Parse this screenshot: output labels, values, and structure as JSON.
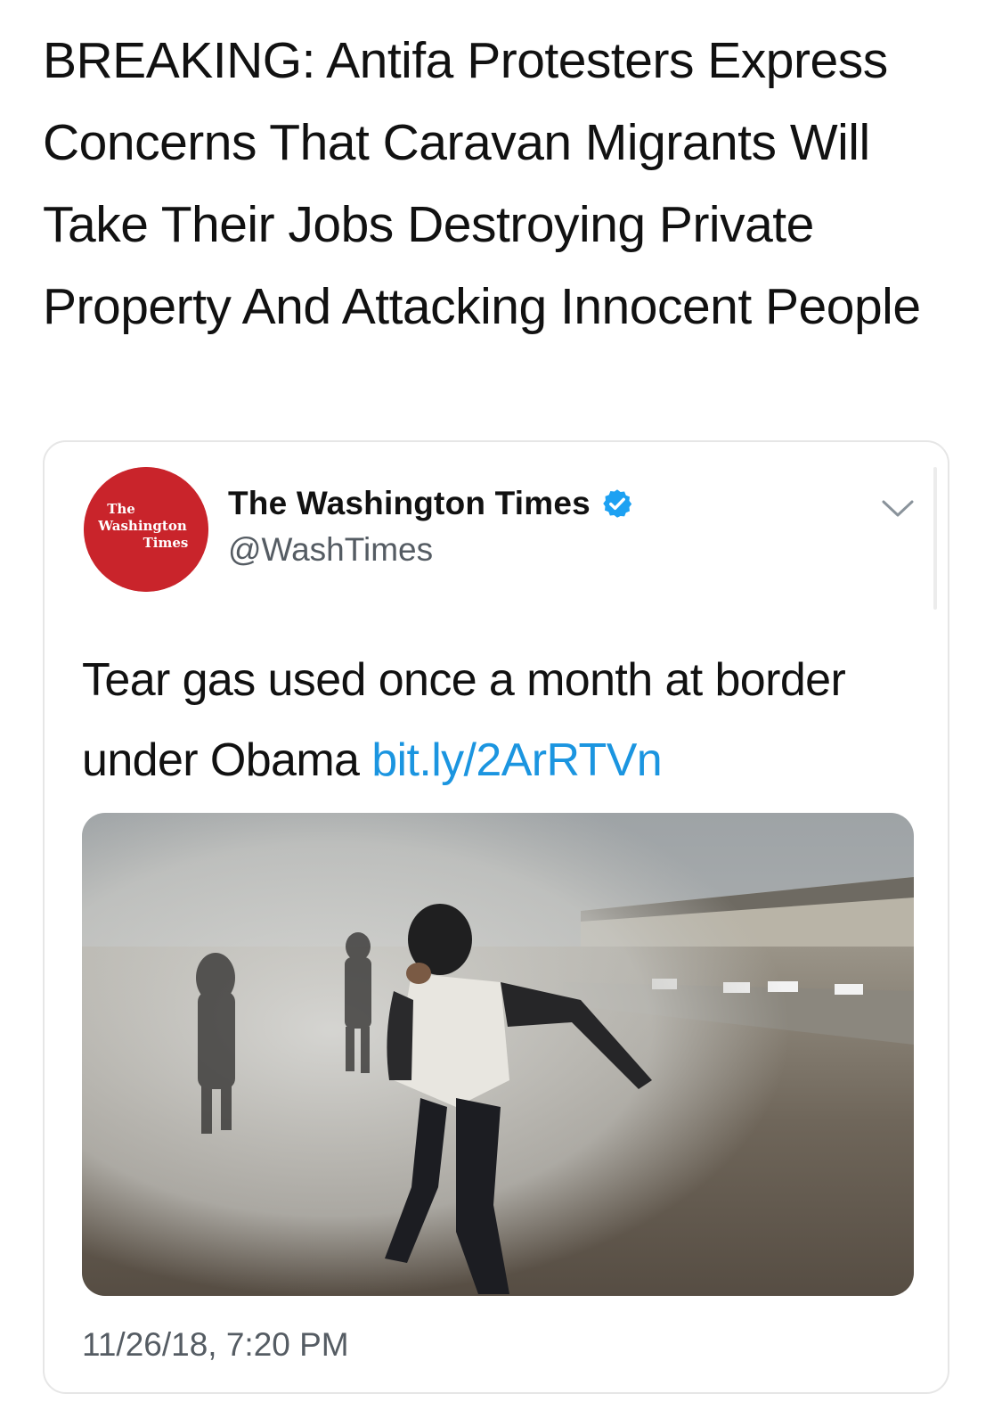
{
  "headline": "BREAKING: Antifa Protesters Express Concerns That Caravan Migrants Will Take Their Jobs Destroying Private Property And Attacking Innocent People",
  "tweet": {
    "avatar_logo_lines": [
      "The",
      "Washington",
      "Times"
    ],
    "display_name": "The Washington Times",
    "handle": "@WashTimes",
    "verified": true,
    "text": "Tear gas used once a month at border under Obama",
    "link": "bit.ly/2ArRTVn",
    "media_image": "photo-tear-gas-border",
    "timestamp": "11/26/18, 7:20 PM"
  },
  "icons": {
    "verified": "verified-badge-icon",
    "menu": "chevron-down-icon"
  },
  "colors": {
    "link": "#1b95e0",
    "verified": "#1da1f2",
    "avatar_bg": "#c9242b",
    "muted": "#555c63"
  }
}
